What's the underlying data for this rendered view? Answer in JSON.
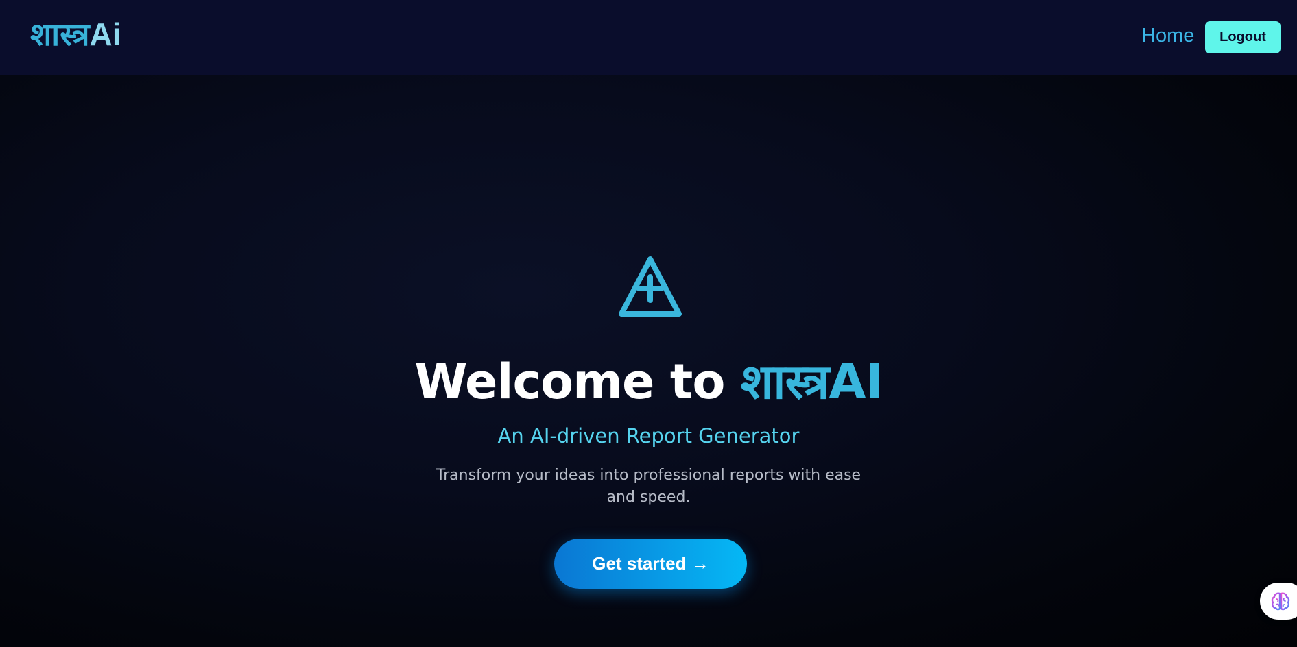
{
  "navbar": {
    "brand_devanagari": "शास्त्र",
    "brand_latin": "Ai",
    "home_label": "Home",
    "logout_label": "Logout"
  },
  "hero": {
    "icon": "triangle-plus-icon",
    "title_prefix": "Welcome to ",
    "title_accent": "शास्त्रAI",
    "subtitle": "An AI-driven Report Generator",
    "description": "Transform your ideas into professional reports with ease and speed.",
    "cta_label": "Get started →"
  },
  "assistant": {
    "icon": "brain-icon"
  },
  "colors": {
    "navbar_bg": "#0a0d2c",
    "accent": "#38b6dd",
    "logout_bg": "#5ff5ea",
    "cta_start": "#0a77d3",
    "cta_end": "#05b8f5",
    "subtitle": "#56d3ee"
  }
}
